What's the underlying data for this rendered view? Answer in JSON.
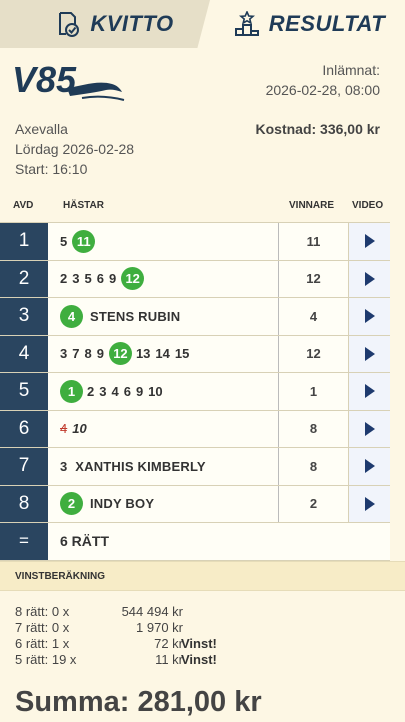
{
  "tabs": [
    {
      "label": "KVITTO",
      "icon": "receipt-check-icon",
      "active": false
    },
    {
      "label": "RESULTAT",
      "icon": "podium-icon",
      "active": true
    }
  ],
  "header": {
    "game": "V85",
    "submitted_label": "Inlämnat:",
    "submitted_date": "2026-02-28, 08:00",
    "track": "Axevalla",
    "race_date": "Lördag 2026-02-28",
    "start": "Start: 16:10",
    "cost": "Kostnad: 336,00 kr"
  },
  "table": {
    "headers": {
      "avd": "AVD",
      "hastar": "HÄSTAR",
      "vinnare": "VINNARE",
      "video": "VIDEO"
    },
    "rows": [
      {
        "avd": "1",
        "horses": [
          {
            "n": "5"
          },
          {
            "n": "11",
            "win": true
          }
        ],
        "winner": "11"
      },
      {
        "avd": "2",
        "horses": [
          {
            "n": "2"
          },
          {
            "n": "3"
          },
          {
            "n": "5"
          },
          {
            "n": "6"
          },
          {
            "n": "9"
          },
          {
            "n": "12",
            "win": true
          }
        ],
        "winner": "12"
      },
      {
        "avd": "3",
        "horses": [
          {
            "n": "4",
            "win": true
          }
        ],
        "name": "STENS RUBIN",
        "winner": "4"
      },
      {
        "avd": "4",
        "horses": [
          {
            "n": "3"
          },
          {
            "n": "7"
          },
          {
            "n": "8"
          },
          {
            "n": "9"
          },
          {
            "n": "12",
            "win": true
          },
          {
            "n": "13"
          },
          {
            "n": "14"
          },
          {
            "n": "15"
          }
        ],
        "winner": "12"
      },
      {
        "avd": "5",
        "horses": [
          {
            "n": "1",
            "win": true
          },
          {
            "n": "2"
          },
          {
            "n": "3"
          },
          {
            "n": "4"
          },
          {
            "n": "6"
          },
          {
            "n": "9"
          },
          {
            "n": "10"
          }
        ],
        "winner": "1"
      },
      {
        "avd": "6",
        "horses": [
          {
            "n": "4",
            "scratched": true
          },
          {
            "n": "10",
            "italic": true
          }
        ],
        "winner": "8"
      },
      {
        "avd": "7",
        "horses": [
          {
            "n": "3"
          }
        ],
        "name": "XANTHIS KIMBERLY",
        "winner": "8"
      },
      {
        "avd": "8",
        "horses": [
          {
            "n": "2",
            "win": true
          }
        ],
        "name": "INDY BOY",
        "winner": "2"
      }
    ],
    "total": {
      "symbol": "=",
      "label": "6 RÄTT"
    }
  },
  "winnings": {
    "title": "VINSTBERÄKNING",
    "rows": [
      {
        "label": "8 rätt: 0 x",
        "amount": "544 494 kr",
        "note": ""
      },
      {
        "label": "7 rätt: 0 x",
        "amount": "1 970 kr",
        "note": ""
      },
      {
        "label": "6 rätt: 1 x",
        "amount": "72 kr",
        "note": "Vinst!"
      },
      {
        "label": "5 rätt: 19 x",
        "amount": "11 kr",
        "note": "Vinst!"
      }
    ],
    "summa": "Summa: 281,00 kr"
  },
  "colors": {
    "background": "#fdf7e4",
    "avd_cell": "#2a4560",
    "win_badge": "#3fae3f",
    "brand": "#1f3b57"
  }
}
